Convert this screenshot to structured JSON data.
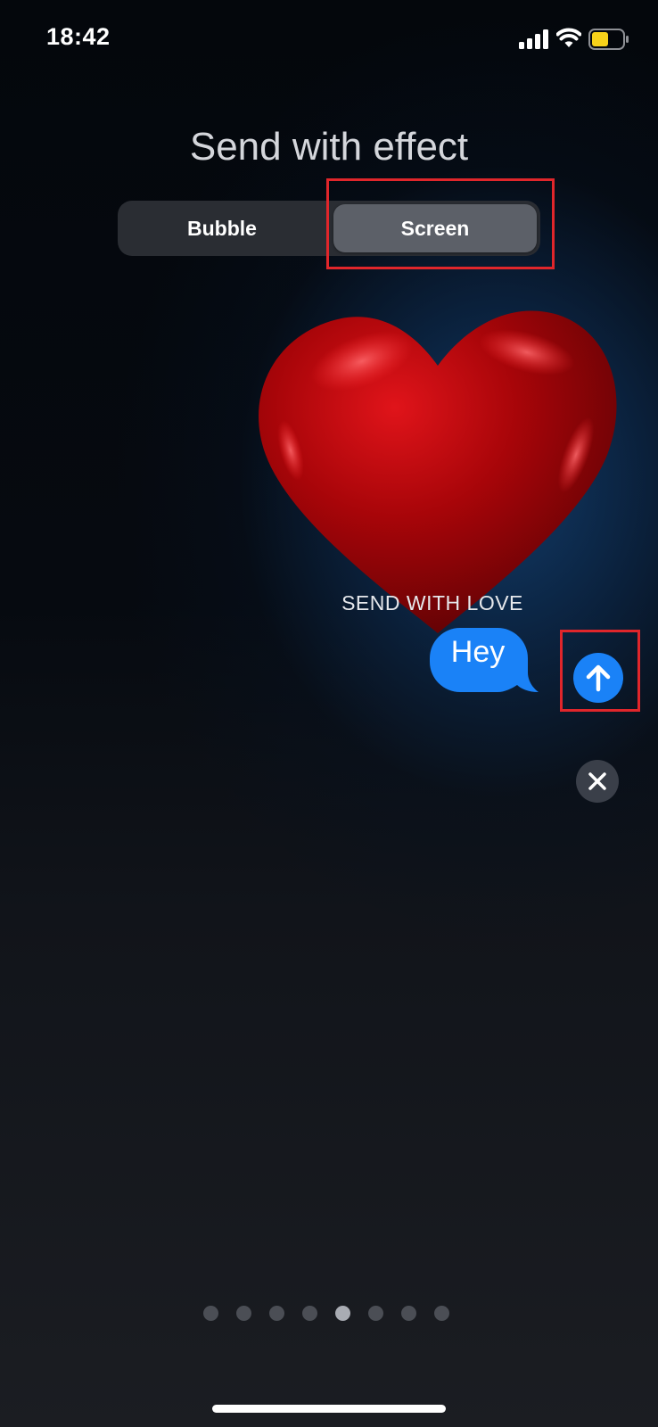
{
  "status_bar": {
    "time": "18:42",
    "icons": [
      "signal-icon",
      "wifi-icon",
      "battery-icon"
    ]
  },
  "header": {
    "title": "Send with effect"
  },
  "segmented_control": {
    "options": [
      "Bubble",
      "Screen"
    ],
    "selected": "Screen"
  },
  "effect": {
    "name": "SEND WITH LOVE",
    "visual": "heart-icon"
  },
  "message": {
    "text": "Hey"
  },
  "page_indicator": {
    "total": 8,
    "current": 5
  },
  "colors": {
    "accent": "#1a82f7",
    "highlight_box": "#e0262b",
    "heart": "#c4070b"
  }
}
